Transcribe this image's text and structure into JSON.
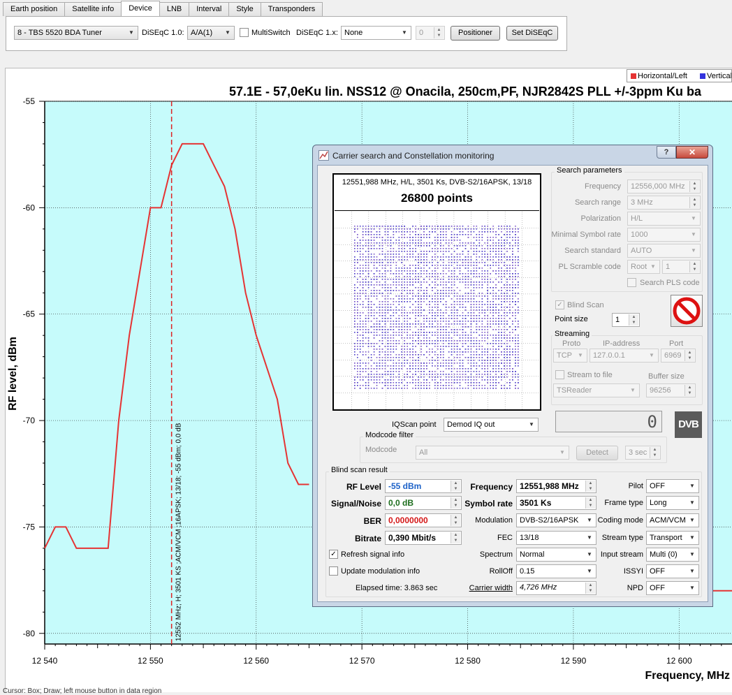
{
  "tabs": [
    "Earth position",
    "Satellite info",
    "Device",
    "LNB",
    "Interval",
    "Style",
    "Transponders"
  ],
  "device": {
    "tuner": "8 - TBS 5520 BDA Tuner",
    "diseqc10_label": "DiSEqC 1.0:",
    "diseqc10_value": "A/A(1)",
    "multiswitch_label": "MultiSwitch",
    "diseqc1x_label": "DiSEqC 1.x:",
    "diseqc1x_value": "None",
    "spin_value": "0",
    "positioner_label": "Positioner",
    "set_diseqc_label": "Set DiSEqC"
  },
  "legend": {
    "horizontal": "Horizontal/Left",
    "vertical": "Vertical/",
    "horizontal_color": "#e53333",
    "vertical_color": "#3333dd"
  },
  "chart_data": {
    "type": "line",
    "title": "57.1E - 57,0eKu lin. NSS12 @ Onacila, 250cm,PF, NJR2842S PLL +/-3ppm Ku ba",
    "xlabel": "Frequency, MHz",
    "ylabel": "RF level, dBm",
    "xlim": [
      12540,
      12605
    ],
    "ylim": [
      -80.5,
      -55
    ],
    "x_ticks": [
      12540,
      12550,
      12560,
      12570,
      12580,
      12590,
      12600
    ],
    "x_tick_labels": [
      "12 540",
      "12 550",
      "12 560",
      "12 570",
      "12 580",
      "12 590",
      "12 600"
    ],
    "y_ticks": [
      -55,
      -60,
      -65,
      -70,
      -75,
      -80
    ],
    "y_tick_labels": [
      "-55",
      "-60",
      "-65",
      "-70",
      "-75",
      "-80"
    ],
    "grid": true,
    "background_color": "#c6fbfb",
    "series": [
      {
        "name": "Horizontal/Left",
        "color": "#e53333",
        "points": [
          [
            12540,
            -76
          ],
          [
            12541,
            -75
          ],
          [
            12542,
            -75
          ],
          [
            12543,
            -76
          ],
          [
            12544,
            -76
          ],
          [
            12545,
            -76
          ],
          [
            12546,
            -76
          ],
          [
            12547,
            -70
          ],
          [
            12548,
            -66
          ],
          [
            12549,
            -63
          ],
          [
            12550,
            -60
          ],
          [
            12551,
            -60
          ],
          [
            12552,
            -58
          ],
          [
            12553,
            -57
          ],
          [
            12554,
            -57
          ],
          [
            12555,
            -57
          ],
          [
            12556,
            -58
          ],
          [
            12557,
            -59
          ],
          [
            12558,
            -61
          ],
          [
            12559,
            -64
          ],
          [
            12560,
            -66
          ],
          [
            12561,
            -67.5
          ],
          [
            12562,
            -69
          ],
          [
            12563,
            -72
          ],
          [
            12564,
            -73
          ],
          [
            12565,
            -73
          ]
        ]
      },
      {
        "color": "#e53333",
        "points": [
          [
            12603,
            -78
          ],
          [
            12605,
            -78
          ]
        ]
      }
    ],
    "marker": {
      "x": 12552,
      "label": "12552 MHz; H; 3501 KS ;ACM/VCM ;16APSK; 13/18; -55 dBm; 0,0 dB"
    }
  },
  "status_text": "Cursor: Box; Draw; left mouse button in data region",
  "dialog": {
    "title": "Carrier search and Constellation monitoring",
    "help": "?",
    "close": "✕",
    "constellation": {
      "info": "12551,988 MHz, H/L, 3501 Ks, DVB-S2/16APSK, 13/18",
      "points_label": "26800 points"
    },
    "search_params": {
      "title": "Search parameters",
      "frequency_label": "Frequency",
      "frequency_value": "12556,000 MHz",
      "range_label": "Search range",
      "range_value": "3 MHz",
      "polarization_label": "Polarization",
      "polarization_value": "H/L",
      "min_sr_label": "Minimal Symbol rate",
      "min_sr_value": "1000",
      "standard_label": "Search standard",
      "standard_value": "AUTO",
      "pls_label": "PL Scramble code",
      "pls_mode": "Root",
      "pls_value": "1",
      "search_pls_label": "Search PLS code"
    },
    "blind_scan_label": "Blind Scan",
    "point_size_label": "Point size",
    "point_size_value": "1",
    "streaming": {
      "title": "Streaming",
      "proto_label": "Proto",
      "proto_value": "TCP",
      "ip_label": "IP-address",
      "ip_value": "127.0.0.1",
      "port_label": "Port",
      "port_value": "6969",
      "stream_file_label": "Stream to file",
      "buffer_label": "Buffer size",
      "reader_value": "TSReader",
      "buffer_value": "96256"
    },
    "digit_display": "0",
    "dvb_logo": "DVB",
    "iqscan_label": "IQScan point",
    "iqscan_value": "Demod IQ out",
    "modcode": {
      "title": "Modcode filter",
      "label": "Modcode",
      "value": "All",
      "detect_label": "Detect",
      "interval_value": "3 sec"
    },
    "result": {
      "title": "Blind scan result",
      "rf_label": "RF Level",
      "rf_value": "-55 dBm",
      "snr_label": "Signal/Noise",
      "snr_value": "0,0 dB",
      "ber_label": "BER",
      "ber_value": "0,0000000",
      "bitrate_label": "Bitrate",
      "bitrate_value": "0,390 Mbit/s",
      "freq_label": "Frequency",
      "freq_value": "12551,988 MHz",
      "sr_label": "Symbol rate",
      "sr_value": "3501 Ks",
      "modulation_label": "Modulation",
      "modulation_value": "DVB-S2/16APSK",
      "fec_label": "FEC",
      "fec_value": "13/18",
      "spectrum_label": "Spectrum",
      "spectrum_value": "Normal",
      "rolloff_label": "RollOff",
      "rolloff_value": "0.15",
      "carrier_width_label": "Carrier width",
      "carrier_width_value": "4,726 MHz",
      "pilot_label": "Pilot",
      "pilot_value": "OFF",
      "frame_label": "Frame type",
      "frame_value": "Long",
      "coding_label": "Coding mode",
      "coding_value": "ACM/VCM",
      "stream_type_label": "Stream type",
      "stream_type_value": "Transport",
      "input_stream_label": "Input stream",
      "input_stream_value": "Multi (0)",
      "issyi_label": "ISSYI",
      "issyi_value": "OFF",
      "npd_label": "NPD",
      "npd_value": "OFF",
      "refresh_label": "Refresh signal info",
      "update_mod_label": "Update modulation info",
      "elapsed": "Elapsed time: 3.863 sec"
    }
  }
}
